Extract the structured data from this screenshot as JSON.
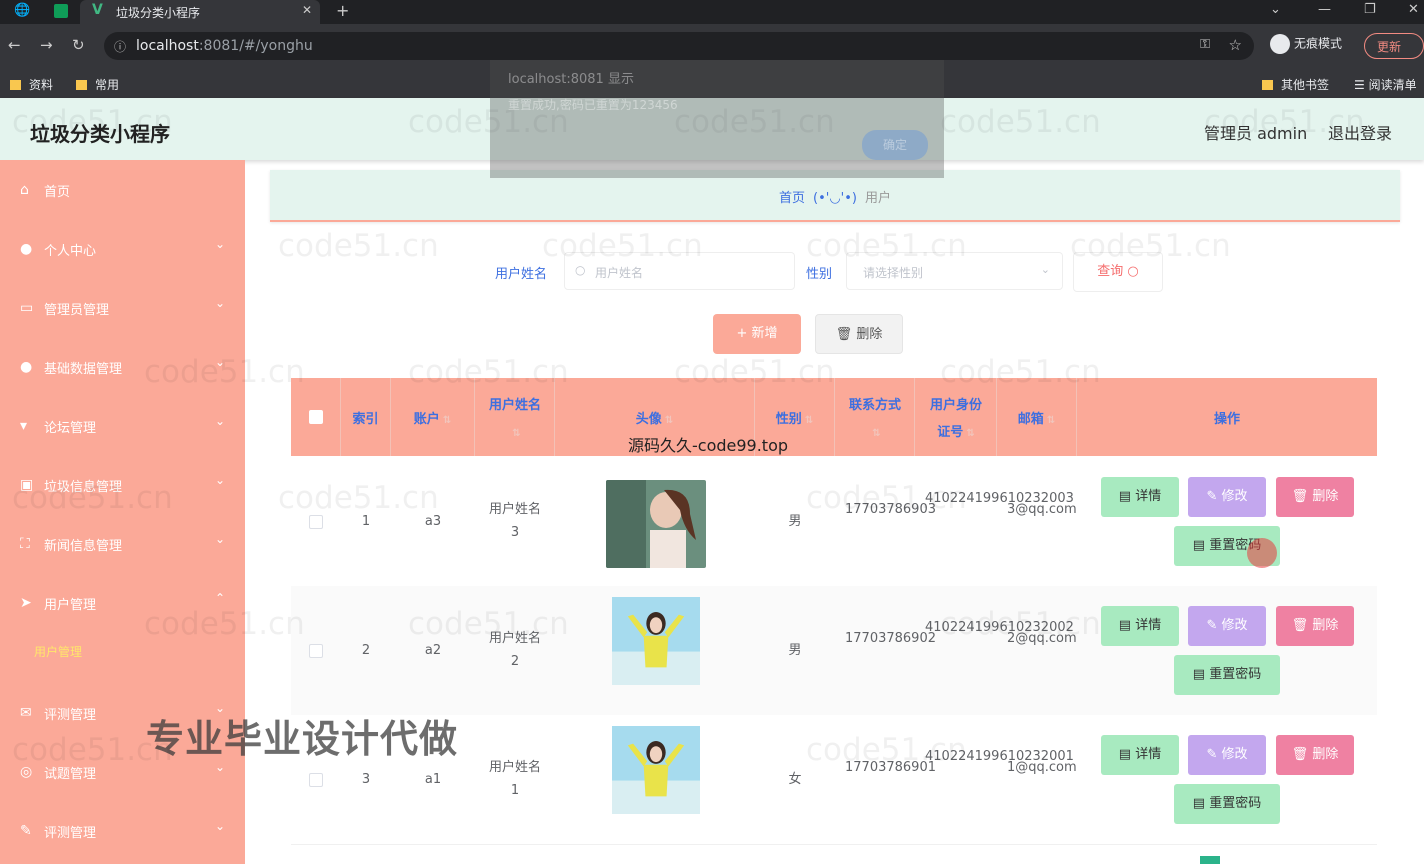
{
  "browser": {
    "tab_title": "垃圾分类小程序",
    "url_host": "localhost",
    "url_rest": ":8081/#/yonghu",
    "incognito_label": "无痕模式",
    "update_label": "更新",
    "bookmarks": [
      "资料",
      "常用"
    ],
    "bookmarks_right": [
      "其他书签",
      "阅读清单"
    ]
  },
  "alert": {
    "line1": "localhost:8081 显示",
    "line2": "重置成功,密码已重置为123456",
    "ok": "确定"
  },
  "header": {
    "title": "垃圾分类小程序",
    "admin_label": "管理员 admin",
    "logout_label": "退出登录"
  },
  "sidebar": {
    "items": [
      {
        "label": "首页",
        "icon": "home-icon"
      },
      {
        "label": "个人中心",
        "icon": "user-icon"
      },
      {
        "label": "管理员管理",
        "icon": "card-icon"
      },
      {
        "label": "基础数据管理",
        "icon": "user-icon"
      },
      {
        "label": "论坛管理",
        "icon": "forum-icon"
      },
      {
        "label": "垃圾信息管理",
        "icon": "trash-icon"
      },
      {
        "label": "新闻信息管理",
        "icon": "news-icon"
      },
      {
        "label": "用户管理",
        "icon": "send-icon"
      },
      {
        "label": "评测管理",
        "icon": "mail-icon"
      },
      {
        "label": "试题管理",
        "icon": "globe-icon"
      },
      {
        "label": "评测管理",
        "icon": "edit-icon"
      }
    ],
    "active_sub": "用户管理"
  },
  "breadcrumb": {
    "home": "首页",
    "face": "(•'◡'•)",
    "current": "用户"
  },
  "filters": {
    "name_label": "用户姓名",
    "name_placeholder": "用户姓名",
    "gender_label": "性别",
    "gender_placeholder": "请选择性别",
    "query_label": "查询"
  },
  "actions": {
    "add_label": "+ 新增",
    "delete_label": "删除"
  },
  "table": {
    "headers": {
      "index": "索引",
      "account": "账户",
      "name": "用户姓名",
      "avatar": "头像",
      "gender": "性别",
      "phone": "联系方式",
      "idcard": "用户身份证号",
      "email": "邮箱",
      "ops": "操作"
    },
    "rows": [
      {
        "index": "1",
        "account": "a3",
        "name": "用户姓名3",
        "gender": "男",
        "phone": "17703786903",
        "idcard": "410224199610232003",
        "email": "3@qq.com"
      },
      {
        "index": "2",
        "account": "a2",
        "name": "用户姓名2",
        "gender": "男",
        "phone": "17703786902",
        "idcard": "410224199610232002",
        "email": "2@qq.com"
      },
      {
        "index": "3",
        "account": "a1",
        "name": "用户姓名1",
        "gender": "女",
        "phone": "17703786901",
        "idcard": "410224199610232001",
        "email": "1@qq.com"
      }
    ],
    "row_buttons": {
      "detail": "详情",
      "edit": "修改",
      "delete": "删除",
      "reset": "重置密码"
    }
  },
  "overlay": {
    "source_text": "源码久久-code99.top",
    "watermark_big": "专业毕业设计代做",
    "watermark": "code51.cn"
  }
}
